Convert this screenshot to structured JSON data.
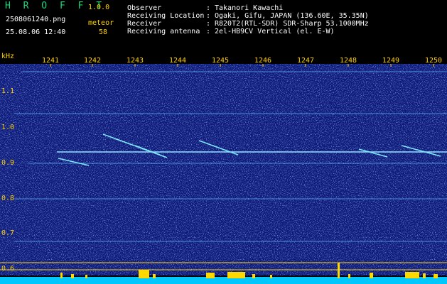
{
  "app": {
    "name": "H R O F F T",
    "version": "1.0.0"
  },
  "left_info": {
    "filename": "2508061240.png",
    "timestamp": "25.08.06 12:40",
    "meteor_label": "meteor",
    "meteor_count": "58"
  },
  "station": {
    "labels": [
      "Observer",
      "Receiving Location",
      "Receiver",
      "Receiving antenna"
    ],
    "separator": ":",
    "values": [
      "Takanori Kawachi",
      "Ogaki, Gifu, JAPAN (136.60E, 35.35N)",
      "R820T2(RTL-SDR) SDR-Sharp 53.1000MHz",
      "2el-HB9CV Vertical (el. E-W)"
    ]
  },
  "axes": {
    "y_unit": "kHz",
    "y_ticks": [
      "1.1",
      "1.0",
      "0.9",
      "0.8",
      "0.7",
      "0.6"
    ],
    "x_ticks": [
      "1241",
      "1242",
      "1243",
      "1244",
      "1245",
      "1246",
      "1247",
      "1248",
      "1249",
      "1250"
    ]
  },
  "colors": {
    "background": "#0d1a7a",
    "text_accent": "#ffd200",
    "logo": "#1fd67a",
    "signal": "#7fe8ff",
    "bottom_strip": "#00c8ff",
    "bottom_peaks": "#ffd800"
  }
}
